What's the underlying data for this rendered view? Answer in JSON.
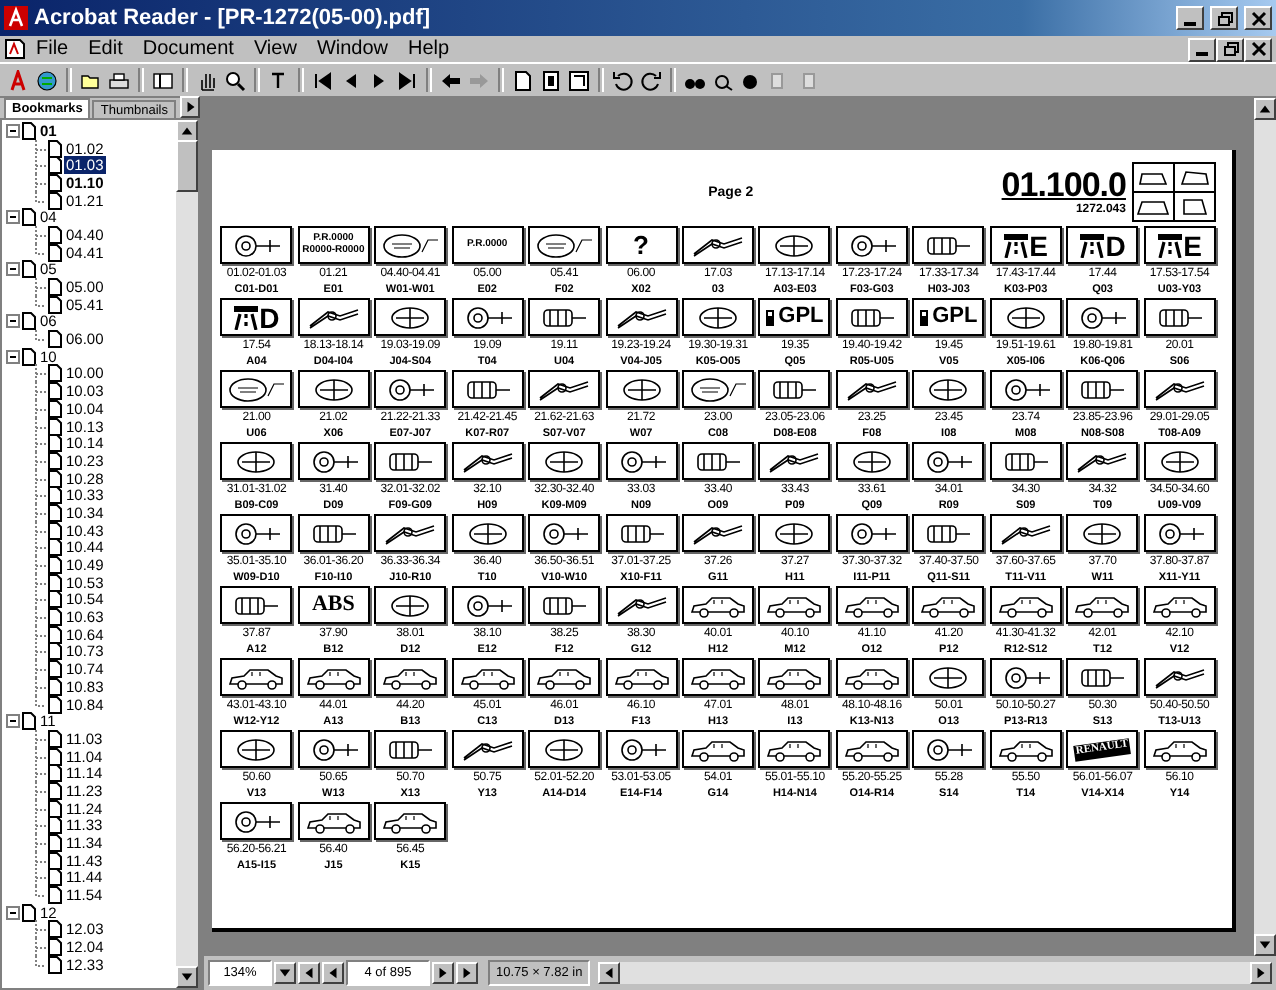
{
  "window": {
    "title": "Acrobat Reader - [PR-1272(05-00).pdf]"
  },
  "menu": [
    "File",
    "Edit",
    "Document",
    "View",
    "Window",
    "Help"
  ],
  "sidebar": {
    "tabs": [
      {
        "label": "Bookmarks",
        "selected": true
      },
      {
        "label": "Thumbnails",
        "selected": false
      }
    ],
    "tree": [
      {
        "label": "01",
        "bold": true,
        "selected": false,
        "expanded": true,
        "children": [
          {
            "label": "01.02",
            "bold": false,
            "selected": false
          },
          {
            "label": "01.03",
            "bold": false,
            "selected": true
          },
          {
            "label": "01.10",
            "bold": true,
            "selected": false
          },
          {
            "label": "01.21",
            "bold": false,
            "selected": false
          }
        ]
      },
      {
        "label": "04",
        "bold": false,
        "selected": false,
        "expanded": true,
        "children": [
          {
            "label": "04.40",
            "bold": false,
            "selected": false
          },
          {
            "label": "04.41",
            "bold": false,
            "selected": false
          }
        ]
      },
      {
        "label": "05",
        "bold": false,
        "selected": false,
        "expanded": true,
        "children": [
          {
            "label": "05.00",
            "bold": false,
            "selected": false
          },
          {
            "label": "05.41",
            "bold": false,
            "selected": false
          }
        ]
      },
      {
        "label": "06",
        "bold": false,
        "selected": false,
        "expanded": true,
        "children": [
          {
            "label": "06.00",
            "bold": false,
            "selected": false
          }
        ]
      },
      {
        "label": "10",
        "bold": false,
        "selected": false,
        "expanded": true,
        "children": [
          {
            "label": "10.00",
            "bold": false,
            "selected": false
          },
          {
            "label": "10.03",
            "bold": false,
            "selected": false
          },
          {
            "label": "10.04",
            "bold": false,
            "selected": false
          },
          {
            "label": "10.13",
            "bold": false,
            "selected": false
          },
          {
            "label": "10.14",
            "bold": false,
            "selected": false
          },
          {
            "label": "10.23",
            "bold": false,
            "selected": false
          },
          {
            "label": "10.28",
            "bold": false,
            "selected": false
          },
          {
            "label": "10.33",
            "bold": false,
            "selected": false
          },
          {
            "label": "10.34",
            "bold": false,
            "selected": false
          },
          {
            "label": "10.43",
            "bold": false,
            "selected": false
          },
          {
            "label": "10.44",
            "bold": false,
            "selected": false
          },
          {
            "label": "10.49",
            "bold": false,
            "selected": false
          },
          {
            "label": "10.53",
            "bold": false,
            "selected": false
          },
          {
            "label": "10.54",
            "bold": false,
            "selected": false
          },
          {
            "label": "10.63",
            "bold": false,
            "selected": false
          },
          {
            "label": "10.64",
            "bold": false,
            "selected": false
          },
          {
            "label": "10.73",
            "bold": false,
            "selected": false
          },
          {
            "label": "10.74",
            "bold": false,
            "selected": false
          },
          {
            "label": "10.83",
            "bold": false,
            "selected": false
          },
          {
            "label": "10.84",
            "bold": false,
            "selected": false
          }
        ]
      },
      {
        "label": "11",
        "bold": false,
        "selected": false,
        "expanded": true,
        "children": [
          {
            "label": "11.03",
            "bold": false,
            "selected": false
          },
          {
            "label": "11.04",
            "bold": false,
            "selected": false
          },
          {
            "label": "11.14",
            "bold": false,
            "selected": false
          },
          {
            "label": "11.23",
            "bold": false,
            "selected": false
          },
          {
            "label": "11.24",
            "bold": false,
            "selected": false
          },
          {
            "label": "11.33",
            "bold": false,
            "selected": false
          },
          {
            "label": "11.34",
            "bold": false,
            "selected": false
          },
          {
            "label": "11.43",
            "bold": false,
            "selected": false
          },
          {
            "label": "11.44",
            "bold": false,
            "selected": false
          },
          {
            "label": "11.54",
            "bold": false,
            "selected": false
          }
        ]
      },
      {
        "label": "12",
        "bold": false,
        "selected": false,
        "expanded": true,
        "children": [
          {
            "label": "12.03",
            "bold": false,
            "selected": false
          },
          {
            "label": "12.04",
            "bold": false,
            "selected": false
          },
          {
            "label": "12.33",
            "bold": false,
            "selected": false
          }
        ]
      }
    ]
  },
  "page": {
    "page_label": "Page 2",
    "section": "01.100.0",
    "reference": "1272.043",
    "items": [
      {
        "kind": "drawing",
        "code": "01.02-01.03",
        "letters": "C01-D01"
      },
      {
        "kind": "text",
        "icon_text": [
          "P.R.0000",
          "R0000-R0000"
        ],
        "code": "01.21",
        "letters": "E01"
      },
      {
        "kind": "oval",
        "code": "04.40-04.41",
        "letters": "W01-W01"
      },
      {
        "kind": "text",
        "icon_text": [
          "P.R.0000"
        ],
        "code": "05.00",
        "letters": "E02"
      },
      {
        "kind": "oval",
        "code": "05.41",
        "letters": "F02"
      },
      {
        "kind": "text",
        "icon_text": [
          "?"
        ],
        "code": "06.00",
        "letters": "X02"
      },
      {
        "kind": "drawing",
        "code": "17.03",
        "letters": "03"
      },
      {
        "kind": "drawing",
        "code": "17.13-17.14",
        "letters": "A03-E03"
      },
      {
        "kind": "drawing",
        "code": "17.23-17.24",
        "letters": "F03-G03"
      },
      {
        "kind": "drawing",
        "code": "17.33-17.34",
        "letters": "H03-J03"
      },
      {
        "kind": "road",
        "icon_text": [
          "E"
        ],
        "code": "17.43-17.44",
        "letters": "K03-P03"
      },
      {
        "kind": "road",
        "icon_text": [
          "D"
        ],
        "code": "17.44",
        "letters": "Q03"
      },
      {
        "kind": "road",
        "icon_text": [
          "E"
        ],
        "code": "17.53-17.54",
        "letters": "U03-Y03"
      },
      {
        "kind": "road",
        "icon_text": [
          "D"
        ],
        "code": "17.54",
        "letters": "A04"
      },
      {
        "kind": "drawing",
        "code": "18.13-18.14",
        "letters": "D04-I04"
      },
      {
        "kind": "drawing",
        "code": "19.03-19.09",
        "letters": "J04-S04"
      },
      {
        "kind": "drawing",
        "code": "19.09",
        "letters": "T04"
      },
      {
        "kind": "drawing",
        "code": "19.11",
        "letters": "U04"
      },
      {
        "kind": "drawing",
        "code": "19.23-19.24",
        "letters": "V04-J05"
      },
      {
        "kind": "drawing",
        "code": "19.30-19.31",
        "letters": "K05-O05"
      },
      {
        "kind": "fuel",
        "icon_text": [
          "GPL"
        ],
        "code": "19.35",
        "letters": "Q05"
      },
      {
        "kind": "drawing",
        "code": "19.40-19.42",
        "letters": "R05-U05"
      },
      {
        "kind": "fuel",
        "icon_text": [
          "GPL"
        ],
        "code": "19.45",
        "letters": "V05"
      },
      {
        "kind": "drawing",
        "code": "19.51-19.61",
        "letters": "X05-I06"
      },
      {
        "kind": "drawing",
        "code": "19.80-19.81",
        "letters": "K06-Q06"
      },
      {
        "kind": "drawing",
        "code": "20.01",
        "letters": "S06"
      },
      {
        "kind": "oval",
        "code": "21.00",
        "letters": "U06"
      },
      {
        "kind": "drawing",
        "code": "21.02",
        "letters": "X06"
      },
      {
        "kind": "drawing",
        "code": "21.22-21.33",
        "letters": "E07-J07"
      },
      {
        "kind": "drawing",
        "code": "21.42-21.45",
        "letters": "K07-R07"
      },
      {
        "kind": "drawing",
        "code": "21.62-21.63",
        "letters": "S07-V07"
      },
      {
        "kind": "drawing",
        "code": "21.72",
        "letters": "W07"
      },
      {
        "kind": "oval",
        "code": "23.00",
        "letters": "C08"
      },
      {
        "kind": "drawing",
        "code": "23.05-23.06",
        "letters": "D08-E08"
      },
      {
        "kind": "drawing",
        "code": "23.25",
        "letters": "F08"
      },
      {
        "kind": "drawing",
        "code": "23.45",
        "letters": "I08"
      },
      {
        "kind": "drawing",
        "code": "23.74",
        "letters": "M08"
      },
      {
        "kind": "drawing",
        "code": "23.85-23.96",
        "letters": "N08-S08"
      },
      {
        "kind": "drawing",
        "code": "29.01-29.05",
        "letters": "T08-A09"
      },
      {
        "kind": "drawing",
        "code": "31.01-31.02",
        "letters": "B09-C09"
      },
      {
        "kind": "drawing",
        "code": "31.40",
        "letters": "D09"
      },
      {
        "kind": "drawing",
        "code": "32.01-32.02",
        "letters": "F09-G09"
      },
      {
        "kind": "drawing",
        "code": "32.10",
        "letters": "H09"
      },
      {
        "kind": "drawing",
        "code": "32.30-32.40",
        "letters": "K09-M09"
      },
      {
        "kind": "drawing",
        "code": "33.03",
        "letters": "N09"
      },
      {
        "kind": "drawing",
        "code": "33.40",
        "letters": "O09"
      },
      {
        "kind": "drawing",
        "code": "33.43",
        "letters": "P09"
      },
      {
        "kind": "drawing",
        "code": "33.61",
        "letters": "Q09"
      },
      {
        "kind": "drawing",
        "code": "34.01",
        "letters": "R09"
      },
      {
        "kind": "drawing",
        "code": "34.30",
        "letters": "S09"
      },
      {
        "kind": "drawing",
        "code": "34.32",
        "letters": "T09"
      },
      {
        "kind": "drawing",
        "code": "34.50-34.60",
        "letters": "U09-V09"
      },
      {
        "kind": "drawing",
        "code": "35.01-35.10",
        "letters": "W09-D10"
      },
      {
        "kind": "drawing",
        "code": "36.01-36.20",
        "letters": "F10-I10"
      },
      {
        "kind": "drawing",
        "code": "36.33-36.34",
        "letters": "J10-R10"
      },
      {
        "kind": "drawing",
        "code": "36.40",
        "letters": "T10"
      },
      {
        "kind": "drawing",
        "code": "36.50-36.51",
        "letters": "V10-W10"
      },
      {
        "kind": "drawing",
        "code": "37.01-37.25",
        "letters": "X10-F11"
      },
      {
        "kind": "drawing",
        "code": "37.26",
        "letters": "G11"
      },
      {
        "kind": "drawing",
        "code": "37.27",
        "letters": "H11"
      },
      {
        "kind": "drawing",
        "code": "37.30-37.32",
        "letters": "I11-P11"
      },
      {
        "kind": "drawing",
        "code": "37.40-37.50",
        "letters": "Q11-S11"
      },
      {
        "kind": "drawing",
        "code": "37.60-37.65",
        "letters": "T11-V11"
      },
      {
        "kind": "drawing",
        "code": "37.70",
        "letters": "W11"
      },
      {
        "kind": "drawing",
        "code": "37.80-37.87",
        "letters": "X11-Y11"
      },
      {
        "kind": "drawing",
        "code": "37.87",
        "letters": "A12"
      },
      {
        "kind": "text",
        "icon_text": [
          "ABS"
        ],
        "code": "37.90",
        "letters": "B12"
      },
      {
        "kind": "drawing",
        "code": "38.01",
        "letters": "D12"
      },
      {
        "kind": "drawing",
        "code": "38.10",
        "letters": "E12"
      },
      {
        "kind": "drawing",
        "code": "38.25",
        "letters": "F12"
      },
      {
        "kind": "drawing",
        "code": "38.30",
        "letters": "G12"
      },
      {
        "kind": "car",
        "code": "40.01",
        "letters": "H12"
      },
      {
        "kind": "car",
        "code": "40.10",
        "letters": "M12"
      },
      {
        "kind": "car",
        "code": "41.10",
        "letters": "O12"
      },
      {
        "kind": "car",
        "code": "41.20",
        "letters": "P12"
      },
      {
        "kind": "car",
        "code": "41.30-41.32",
        "letters": "R12-S12"
      },
      {
        "kind": "car",
        "code": "42.01",
        "letters": "T12"
      },
      {
        "kind": "car",
        "code": "42.10",
        "letters": "V12"
      },
      {
        "kind": "car",
        "code": "43.01-43.10",
        "letters": "W12-Y12"
      },
      {
        "kind": "car",
        "code": "44.01",
        "letters": "A13"
      },
      {
        "kind": "car",
        "code": "44.20",
        "letters": "B13"
      },
      {
        "kind": "car",
        "code": "45.01",
        "letters": "C13"
      },
      {
        "kind": "car",
        "code": "46.01",
        "letters": "D13"
      },
      {
        "kind": "car",
        "code": "46.10",
        "letters": "F13"
      },
      {
        "kind": "car",
        "code": "47.01",
        "letters": "H13"
      },
      {
        "kind": "car",
        "code": "48.01",
        "letters": "I13"
      },
      {
        "kind": "car",
        "code": "48.10-48.16",
        "letters": "K13-N13"
      },
      {
        "kind": "drawing",
        "code": "50.01",
        "letters": "O13"
      },
      {
        "kind": "drawing",
        "code": "50.10-50.27",
        "letters": "P13-R13"
      },
      {
        "kind": "drawing",
        "code": "50.30",
        "letters": "S13"
      },
      {
        "kind": "drawing",
        "code": "50.40-50.50",
        "letters": "T13-U13"
      },
      {
        "kind": "drawing",
        "code": "50.60",
        "letters": "V13"
      },
      {
        "kind": "drawing",
        "code": "50.65",
        "letters": "W13"
      },
      {
        "kind": "drawing",
        "code": "50.70",
        "letters": "X13"
      },
      {
        "kind": "drawing",
        "code": "50.75",
        "letters": "Y13"
      },
      {
        "kind": "drawing",
        "code": "52.01-52.20",
        "letters": "A14-D14"
      },
      {
        "kind": "drawing",
        "code": "53.01-53.05",
        "letters": "E14-F14"
      },
      {
        "kind": "car",
        "code": "54.01",
        "letters": "G14"
      },
      {
        "kind": "car",
        "code": "55.01-55.10",
        "letters": "H14-N14"
      },
      {
        "kind": "car",
        "code": "55.20-55.25",
        "letters": "O14-R14"
      },
      {
        "kind": "drawing",
        "code": "55.28",
        "letters": "S14"
      },
      {
        "kind": "car",
        "code": "55.50",
        "letters": "T14"
      },
      {
        "kind": "logo",
        "icon_text": [
          "RENAULT"
        ],
        "code": "56.01-56.07",
        "letters": "V14-X14"
      },
      {
        "kind": "car",
        "code": "56.10",
        "letters": "Y14"
      },
      {
        "kind": "drawing",
        "code": "56.20-56.21",
        "letters": "A15-I15"
      },
      {
        "kind": "car",
        "code": "56.40",
        "letters": "J15"
      },
      {
        "kind": "car",
        "code": "56.45",
        "letters": "K15"
      }
    ]
  },
  "status_bar": {
    "zoom": "134%",
    "page": "4 of 895",
    "size": "10.75 × 7.82 in"
  }
}
